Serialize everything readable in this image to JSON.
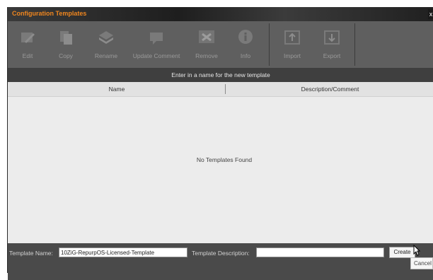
{
  "window": {
    "title": "Configuration Templates",
    "close_label": "x"
  },
  "toolbar": {
    "buttons": [
      {
        "label": "Edit",
        "icon": "pencil-icon"
      },
      {
        "label": "Copy",
        "icon": "copy-icon"
      },
      {
        "label": "Rename",
        "icon": "rename-icon"
      },
      {
        "label": "Update Comment",
        "icon": "comment-icon"
      },
      {
        "label": "Remove",
        "icon": "remove-icon"
      },
      {
        "label": "Info",
        "icon": "info-icon"
      },
      {
        "label": "Import",
        "icon": "import-icon"
      },
      {
        "label": "Export",
        "icon": "export-icon"
      }
    ]
  },
  "banner": {
    "text": "Enter in a name for the new template"
  },
  "table": {
    "columns": [
      "Name",
      "Description/Comment"
    ],
    "empty_text": "No Templates Found"
  },
  "footer": {
    "name_label": "Template Name:",
    "name_value": "10ZiG-RepurpOS-Licensed-Template",
    "desc_label": "Template Description:",
    "desc_value": "",
    "create_label": "Create",
    "tooltip": "Cancel"
  }
}
